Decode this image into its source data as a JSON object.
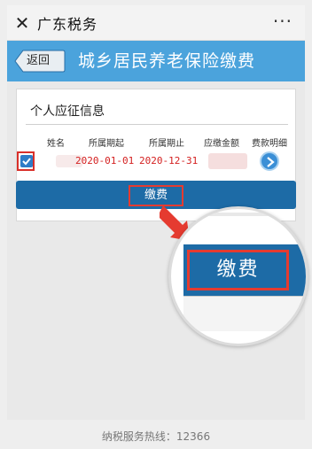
{
  "topbar": {
    "title": "广东税务",
    "close_icon": "close-icon",
    "more_icon": "more-icon",
    "more_text": "···"
  },
  "banner": {
    "back_label": "返回",
    "title": "城乡居民养老保险缴费",
    "color": "#4ba3dc"
  },
  "section": {
    "title": "个人应征信息"
  },
  "table": {
    "headers": [
      "姓名",
      "所属期起",
      "所属期止",
      "应缴金额",
      "费款明细"
    ],
    "rows": [
      {
        "checked": true,
        "name": "",
        "start": "2020-01-01",
        "end": "2020-12-31",
        "amount": ""
      }
    ]
  },
  "pay_button": {
    "label": "缴费",
    "color": "#1d6ba6"
  },
  "zoom": {
    "label": "缴费"
  },
  "footer": {
    "hotline": "纳税服务热线：12366"
  },
  "colors": {
    "highlight": "#e53b30",
    "date_text": "#d42020"
  }
}
